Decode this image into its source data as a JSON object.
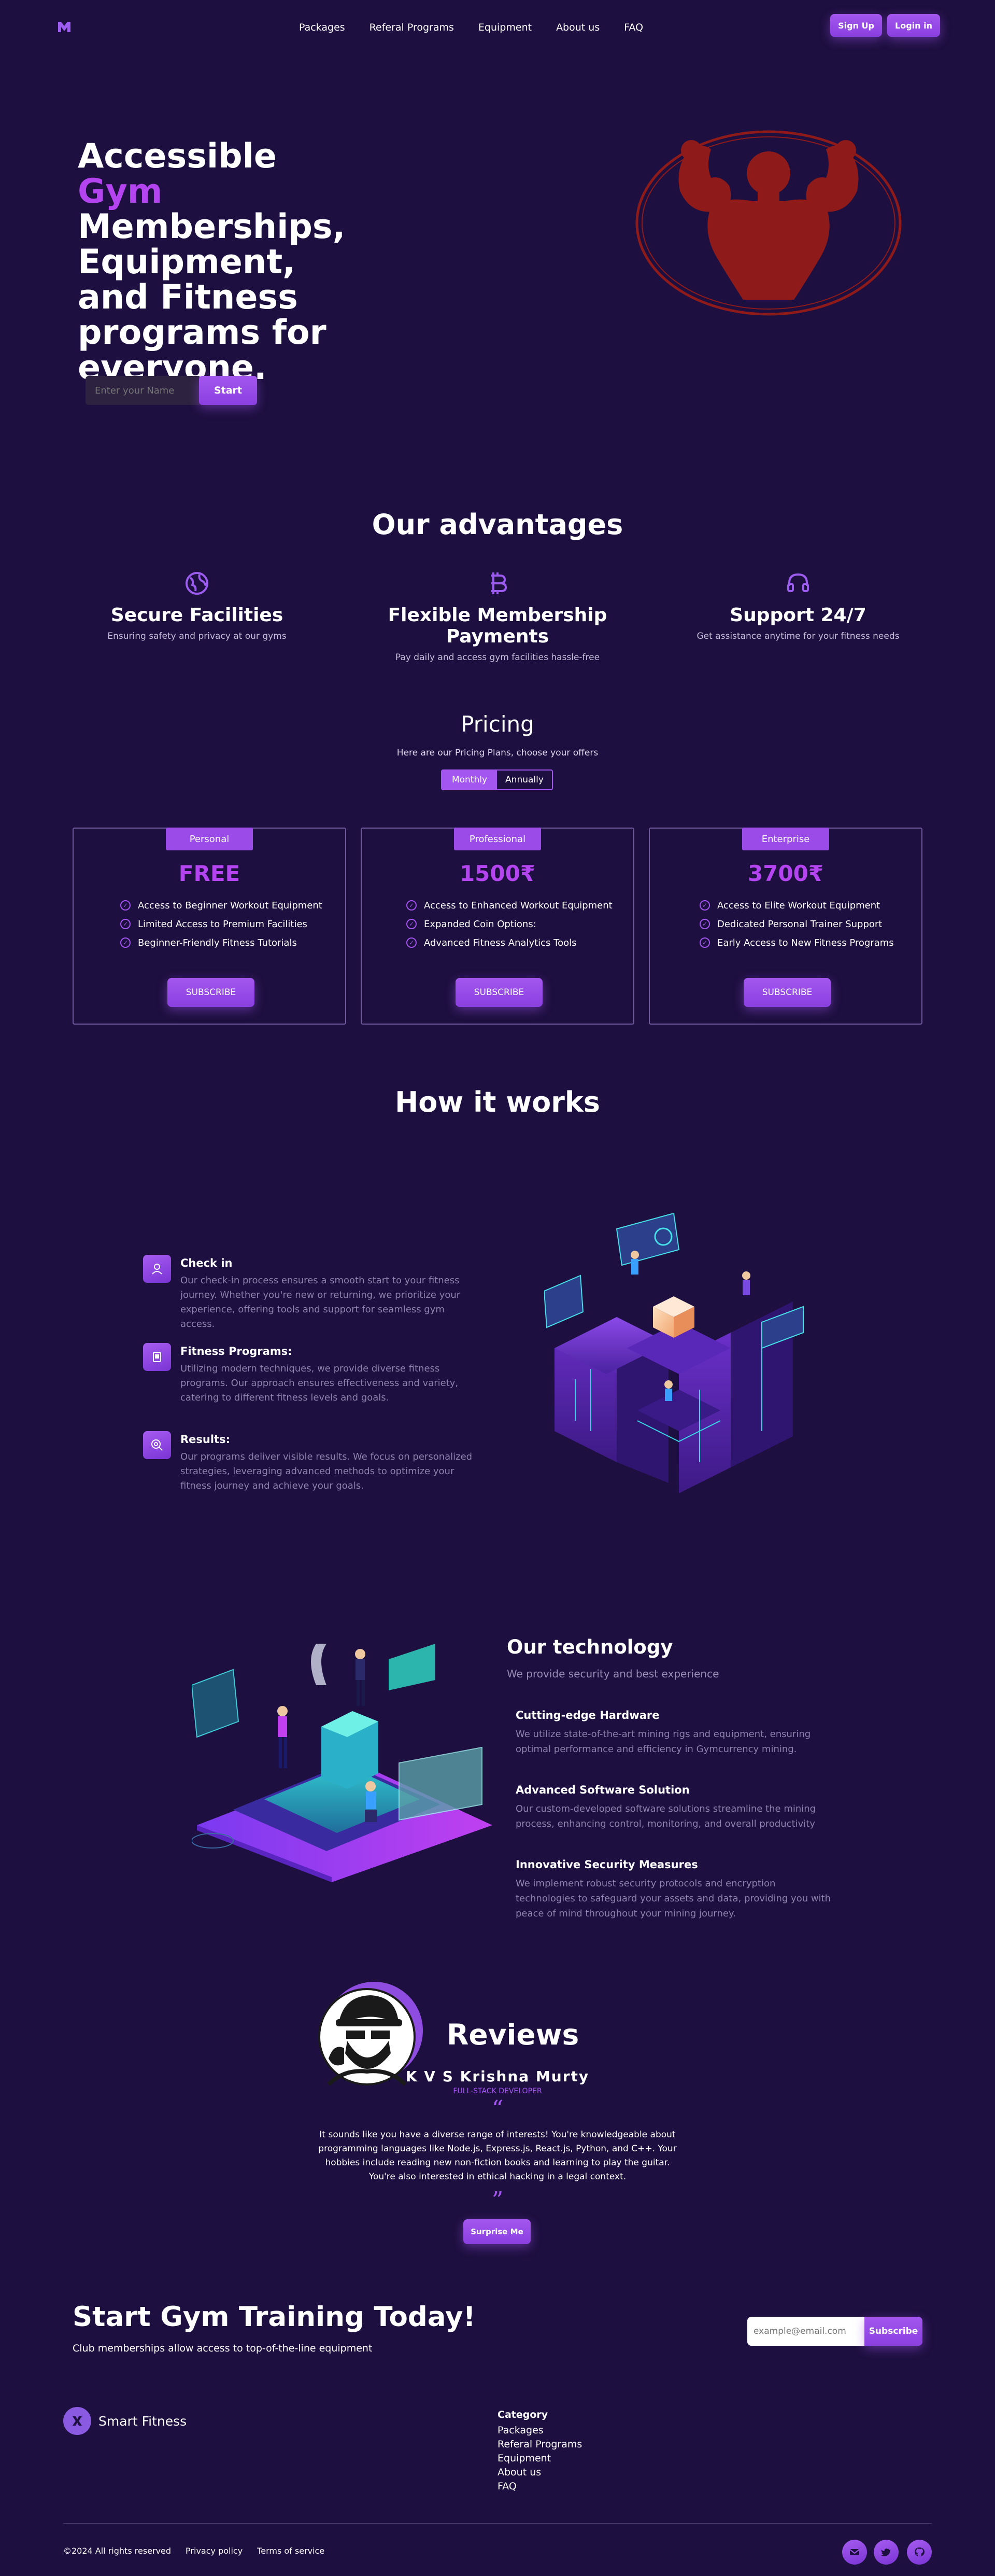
{
  "nav": {
    "links": [
      "Packages",
      "Referal Programs",
      "Equipment",
      "About us",
      "FAQ"
    ],
    "signup": "Sign Up",
    "login": "Login in"
  },
  "hero": {
    "title_part1": "Accessible ",
    "title_highlight": "Gym",
    "title_part2": "Memberships, Equipment, and Fitness programs for everyone.",
    "name_placeholder": "Enter your Name",
    "start": "Start"
  },
  "advantages": {
    "heading": "Our advantages",
    "items": [
      {
        "title": "Secure Facilities",
        "desc": "Ensuring safety and privacy at our gyms",
        "icon": "globe-icon"
      },
      {
        "title": "Flexible Membership Payments",
        "desc": "Pay daily and access gym facilities hassle-free",
        "icon": "bitcoin-icon"
      },
      {
        "title": "Support 24/7",
        "desc": "Get assistance anytime for your fitness needs",
        "icon": "headset-icon"
      }
    ]
  },
  "pricing": {
    "heading": "Pricing",
    "subheading": "Here are our Pricing Plans, choose your offers",
    "toggle": [
      "Monthly",
      "Annually"
    ],
    "plans": [
      {
        "tag": "Personal",
        "price": "FREE",
        "features": [
          "Access to Beginner Workout Equipment",
          "Limited Access to Premium Facilities",
          "Beginner-Friendly Fitness Tutorials"
        ],
        "cta": "SUBSCRIBE"
      },
      {
        "tag": "Professional",
        "price": "1500₹",
        "features": [
          "Access to Enhanced Workout Equipment",
          "Expanded Coin Options:",
          "Advanced Fitness Analytics Tools"
        ],
        "cta": "SUBSCRIBE"
      },
      {
        "tag": "Enterprise",
        "price": "3700₹",
        "features": [
          "Access to Elite Workout Equipment",
          "Dedicated Personal Trainer Support",
          "Early Access to New Fitness Programs"
        ],
        "cta": "SUBSCRIBE"
      }
    ]
  },
  "how": {
    "heading": "How it works",
    "steps": [
      {
        "title": "Check in",
        "text": "Our check-in process ensures a smooth start to your fitness journey. Whether you're new or returning, we prioritize your experience, offering tools and support for seamless gym access.",
        "icon": "user-icon"
      },
      {
        "title": "Fitness Programs:",
        "text": "Utilizing modern techniques, we provide diverse fitness programs. Our approach ensures effectiveness and variety, catering to different fitness levels and goals.",
        "icon": "tablet-icon"
      },
      {
        "title": "Results:",
        "text": "Our programs deliver visible results. We focus on personalized strategies, leveraging advanced methods to optimize your fitness journey and achieve your goals.",
        "icon": "target-icon"
      }
    ]
  },
  "tech": {
    "heading": "Our technology",
    "subheading": "We provide security and best experience",
    "items": [
      {
        "title": "Cutting-edge Hardware",
        "text": "We utilize state-of-the-art mining rigs and equipment, ensuring optimal performance and efficiency in Gymcurrency mining."
      },
      {
        "title": "Advanced Software Solution",
        "text": "Our custom-developed software solutions streamline the mining process, enhancing control, monitoring, and overall productivity"
      },
      {
        "title": "Innovative Security Measures",
        "text": "We implement robust security protocols and encryption technologies to safeguard your assets and data, providing you with peace of mind throughout your mining journey."
      }
    ]
  },
  "reviews": {
    "heading": "Reviews",
    "name": "K V S Krishna Murty",
    "role": "FULL-STACK DEVELOPER",
    "quote": "It sounds like you have a diverse range of interests! You're knowledgeable about programming languages like Node.js, Express.js, React.js, Python, and C++. Your hobbies include reading new non-fiction books and learning to play the guitar. You're also interested in ethical hacking in a legal context.",
    "open_quote": "“",
    "close_quote": "”",
    "cta": "Surprise Me"
  },
  "cta_band": {
    "heading": "Start Gym Training Today!",
    "sub": "Club memberships allow access to top-of-the-line equipment",
    "email_placeholder": "example@email.com",
    "subscribe": "Subscribe"
  },
  "footer": {
    "brand": "Smart Fitness",
    "category_heading": "Category",
    "links": [
      "Packages",
      "Referal Programs",
      "Equipment",
      "About us",
      "FAQ"
    ],
    "copyright": "©2024 All rights reserved",
    "privacy": "Privacy policy",
    "terms": "Terms of service",
    "socials": [
      "mail-icon",
      "twitter-icon",
      "github-icon"
    ]
  },
  "colors": {
    "background": "#1d0f3f",
    "accent": "#a456f0",
    "highlight": "#b443f0",
    "logo_red": "#8f1a1a"
  }
}
